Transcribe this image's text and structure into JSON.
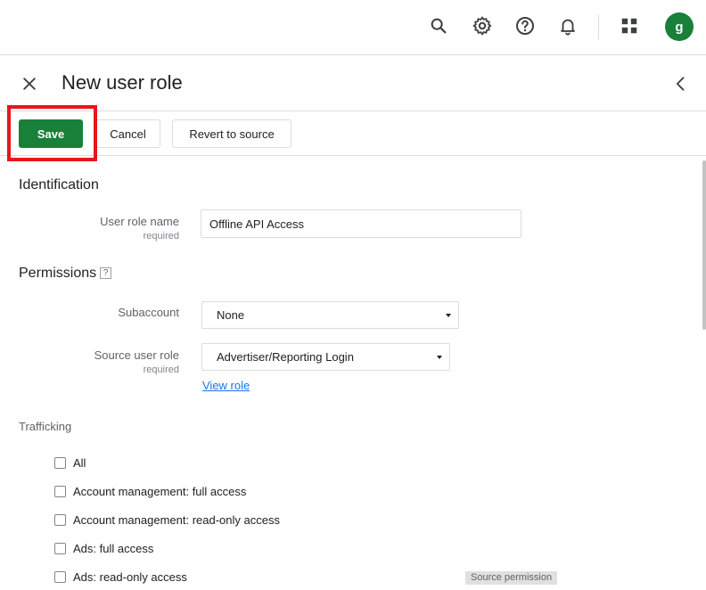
{
  "topbar": {
    "icons": [
      "search-icon",
      "gear-icon",
      "help-icon",
      "bell-icon",
      "apps-grid-icon"
    ],
    "avatar_initial": "g",
    "avatar_color": "#188038"
  },
  "header": {
    "title": "New user role"
  },
  "toolbar": {
    "save_label": "Save",
    "cancel_label": "Cancel",
    "revert_label": "Revert to source"
  },
  "identification": {
    "section_title": "Identification",
    "user_role_name_label": "User role name",
    "required_label": "required",
    "user_role_name_value": "Offline API Access"
  },
  "permissions": {
    "section_title": "Permissions",
    "help_badge": "?",
    "subaccount_label": "Subaccount",
    "subaccount_value": "None",
    "source_user_role_label": "Source user role",
    "required_label": "required",
    "source_user_role_value": "Advertiser/Reporting Login",
    "view_role_link": "View role"
  },
  "trafficking": {
    "subhead": "Trafficking",
    "items": [
      {
        "label": "All",
        "checked": false
      },
      {
        "label": "Account management: full access",
        "checked": false
      },
      {
        "label": "Account management: read-only access",
        "checked": false
      },
      {
        "label": "Ads: full access",
        "checked": false
      },
      {
        "label": "Ads: read-only access",
        "checked": false
      }
    ],
    "source_permission_tag": "Source permission"
  },
  "colors": {
    "accent_green": "#188038",
    "link_blue": "#1a73e8",
    "highlight_red": "#e8151b"
  }
}
